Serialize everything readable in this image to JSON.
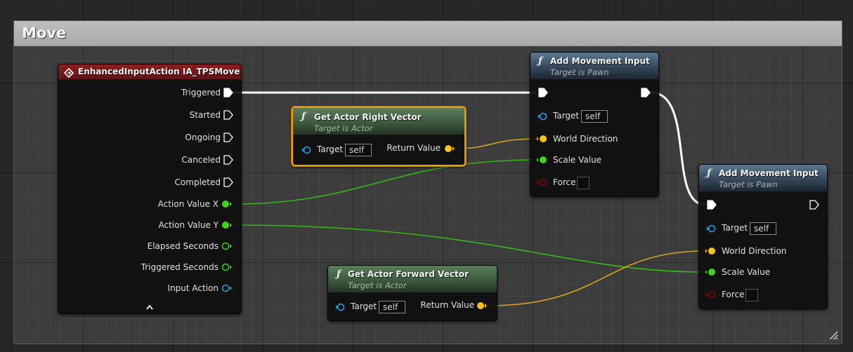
{
  "comment": {
    "title": "Move"
  },
  "event_node": {
    "title": "EnhancedInputAction IA_TPSMove",
    "pins": [
      "Triggered",
      "Started",
      "Ongoing",
      "Canceled",
      "Completed",
      "Action Value X",
      "Action Value Y",
      "Elapsed Seconds",
      "Triggered Seconds",
      "Input Action"
    ],
    "collapse_icon": "chevron-up-icon"
  },
  "right_vector_node": {
    "title": "Get Actor Right Vector",
    "subtitle": "Target is Actor",
    "target_label": "Target",
    "target_value": "self",
    "return_label": "Return Value"
  },
  "forward_vector_node": {
    "title": "Get Actor Forward Vector",
    "subtitle": "Target is Actor",
    "target_label": "Target",
    "target_value": "self",
    "return_label": "Return Value"
  },
  "movement_node_1": {
    "title": "Add Movement Input",
    "subtitle": "Target is Pawn",
    "target_label": "Target",
    "target_value": "self",
    "world_direction_label": "World Direction",
    "scale_value_label": "Scale Value",
    "force_label": "Force"
  },
  "movement_node_2": {
    "title": "Add Movement Input",
    "subtitle": "Target is Pawn",
    "target_label": "Target",
    "target_value": "self",
    "world_direction_label": "World Direction",
    "scale_value_label": "Scale Value",
    "force_label": "Force"
  },
  "colors": {
    "exec": "#ffffff",
    "float": "#3fd21b",
    "vector": "#f5c21c",
    "object": "#1aa7ec",
    "bool": "#950000",
    "selection": "#f0a000",
    "event_header": "#8c1f1f",
    "function_header": "#35475a",
    "pure_header": "#3d5a3f"
  }
}
